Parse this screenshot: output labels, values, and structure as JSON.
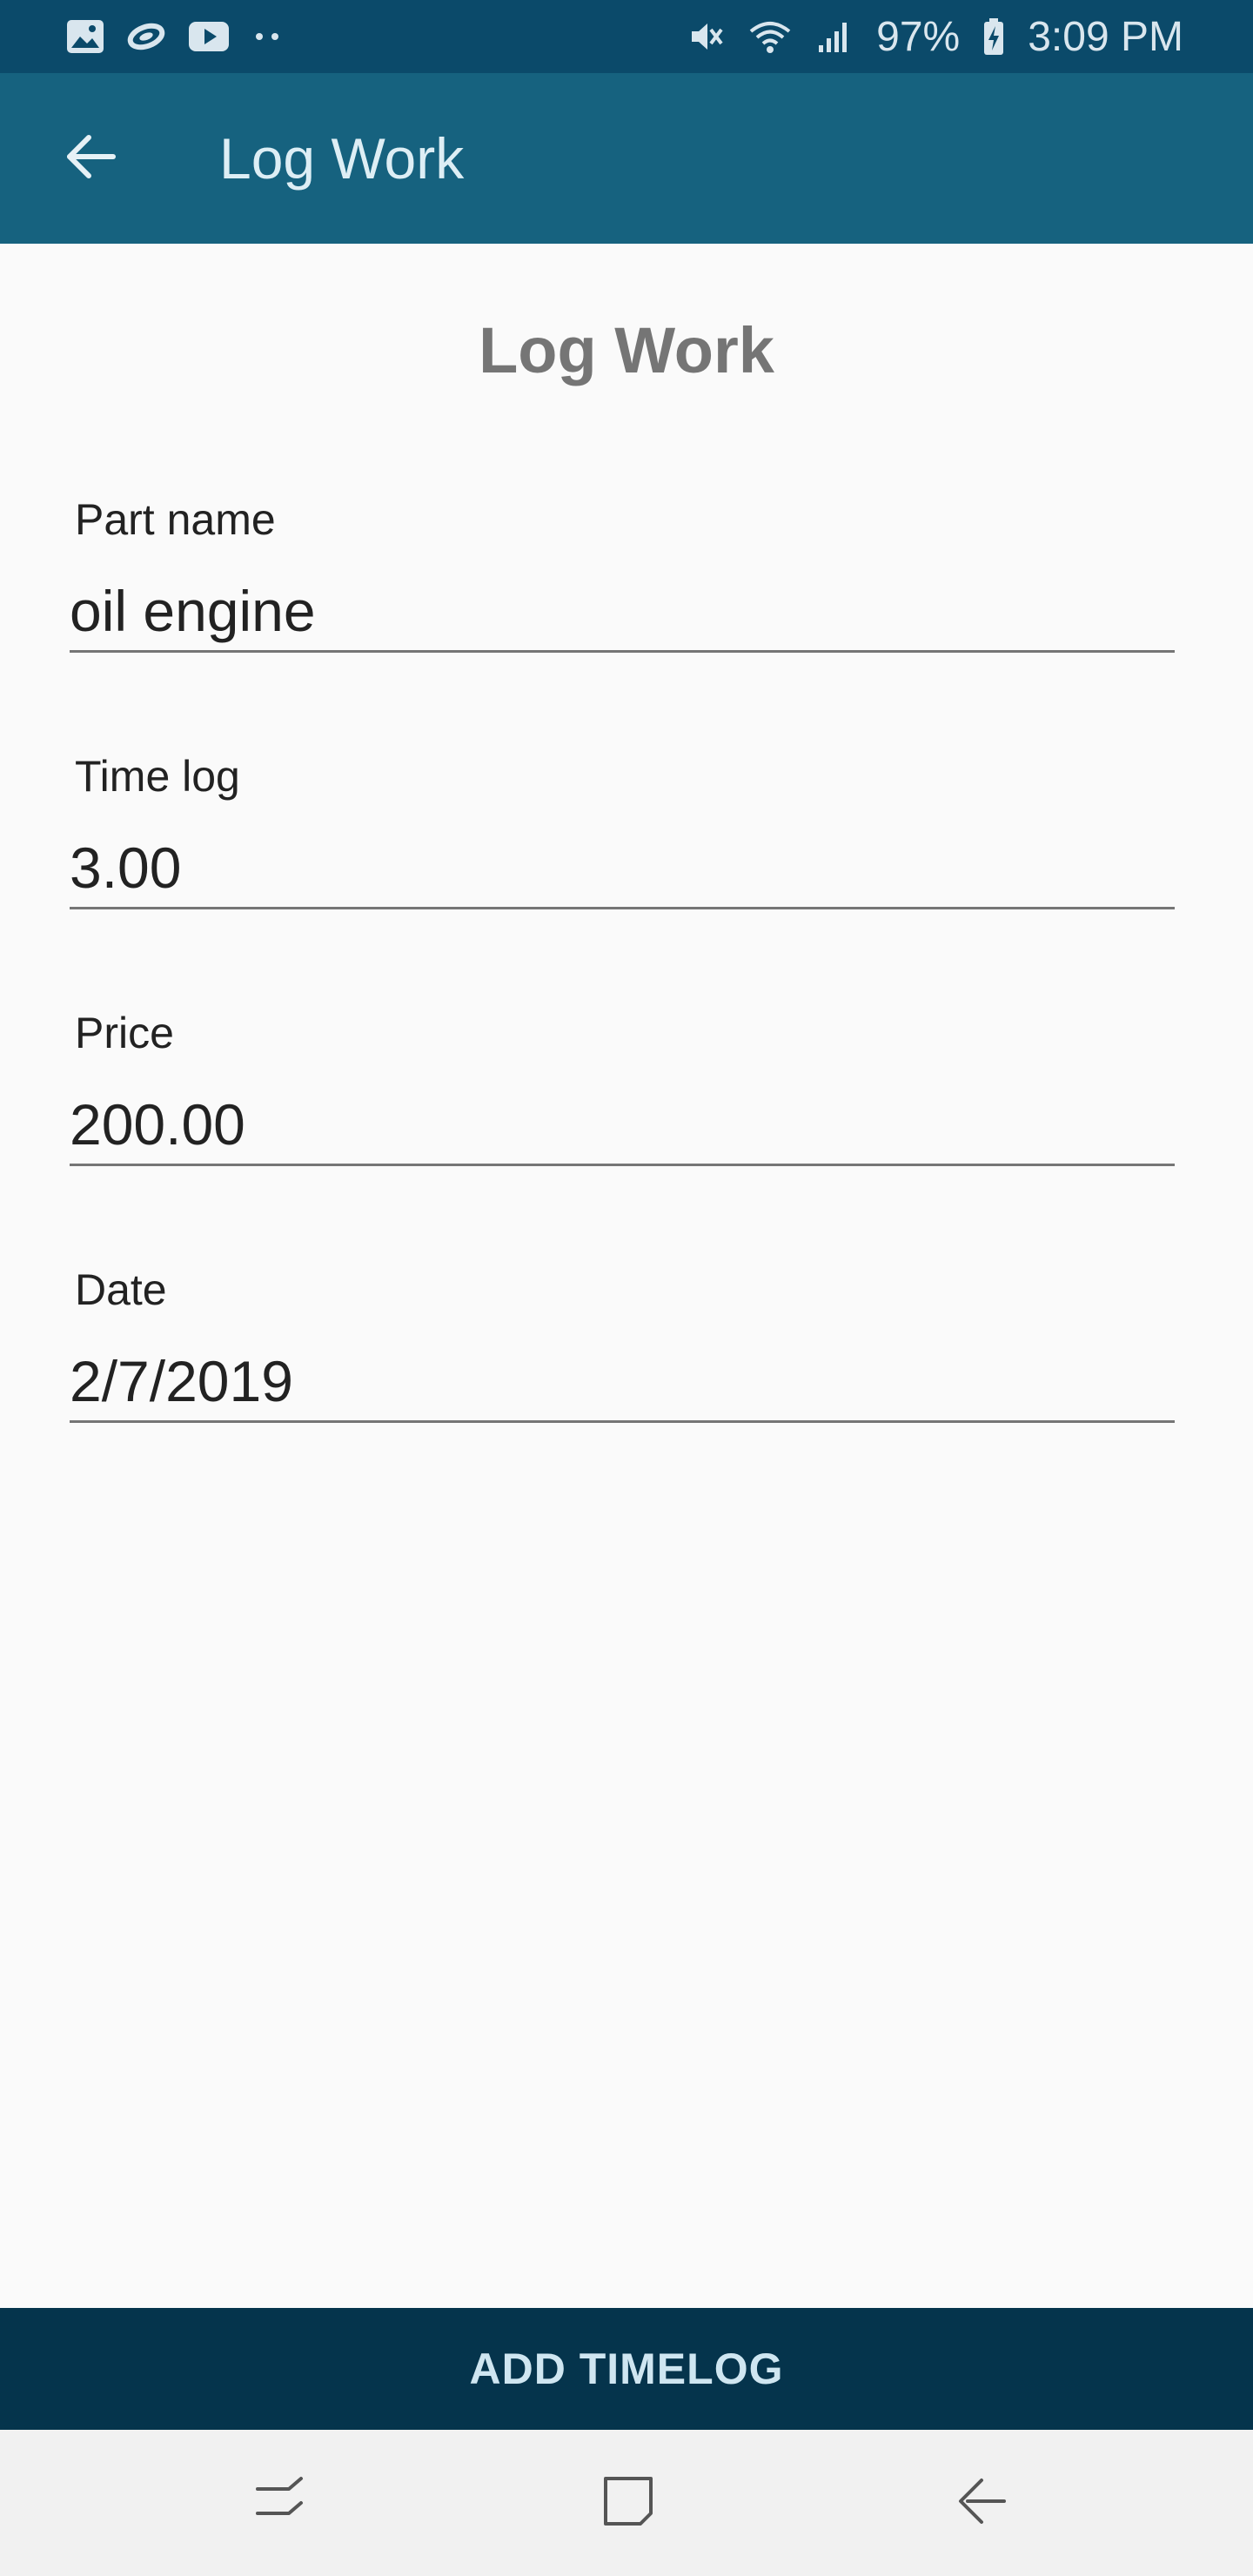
{
  "status_bar": {
    "battery": "97%",
    "time": "3:09 PM",
    "left_icons": [
      "gallery-icon",
      "link-icon",
      "youtube-icon",
      "more-dots-icon"
    ],
    "right_icons": [
      "mute-icon",
      "wifi-icon",
      "signal-icon",
      "battery-charging-icon"
    ]
  },
  "app_bar": {
    "title": "Log Work",
    "back_icon": "arrow-left-icon",
    "background": "#16627f"
  },
  "main": {
    "heading": "Log Work",
    "fields": [
      {
        "label": "Part name",
        "value": "oil engine"
      },
      {
        "label": "Time log",
        "value": "3.00"
      },
      {
        "label": "Price",
        "value": "200.00"
      },
      {
        "label": "Date",
        "value": "2/7/2019"
      }
    ]
  },
  "actions": {
    "add_label": "ADD TIMELOG",
    "background": "#05344c"
  },
  "nav_bar": {
    "icons": [
      "recents-icon",
      "home-icon",
      "back-icon"
    ]
  }
}
